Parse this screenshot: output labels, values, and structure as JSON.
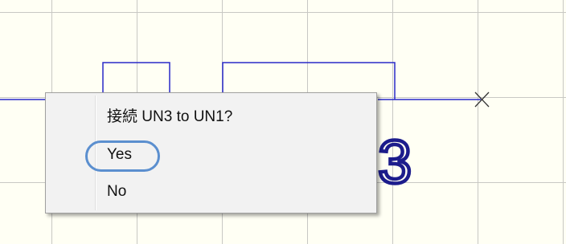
{
  "dialog": {
    "prompt": "接続 UN3 to UN1?",
    "yes_label": "Yes",
    "no_label": "No"
  },
  "schematic": {
    "partial_designator": "3",
    "colors": {
      "background": "#fffff4",
      "grid": "#c8c8c4",
      "wire": "#2828c8",
      "component": "#1c1c8c",
      "highlight": "#5b8fcf"
    },
    "icons": [
      "no-connect-x-icon"
    ]
  }
}
